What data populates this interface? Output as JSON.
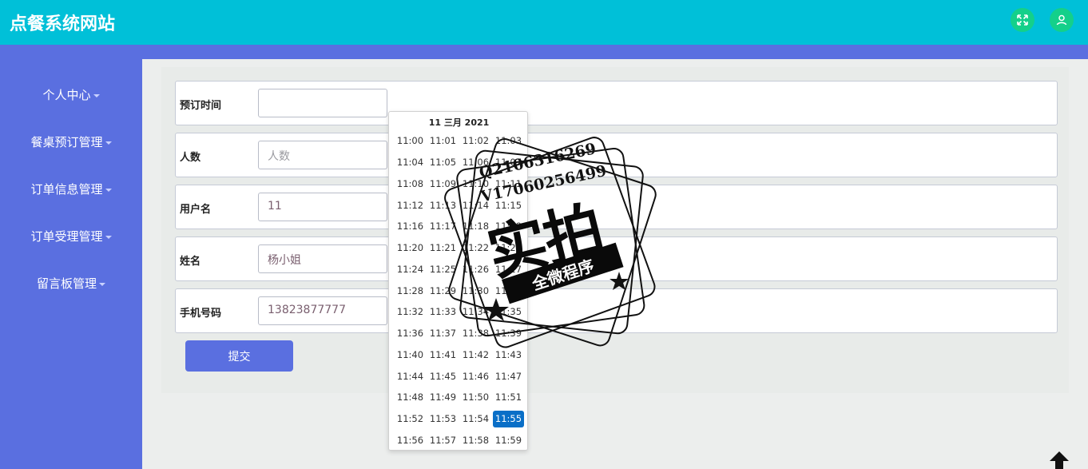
{
  "app": {
    "title": "点餐系统网站"
  },
  "header": {
    "buttons": [
      {
        "name": "fullscreen",
        "icon": "expand-icon"
      },
      {
        "name": "user",
        "icon": "user-icon"
      }
    ]
  },
  "sidebar": {
    "items": [
      {
        "label": "个人中心"
      },
      {
        "label": "餐桌预订管理"
      },
      {
        "label": "订单信息管理"
      },
      {
        "label": "订单受理管理"
      },
      {
        "label": "留言板管理"
      }
    ]
  },
  "form": {
    "fields": [
      {
        "label": "预订时间",
        "value": "",
        "placeholder": ""
      },
      {
        "label": "人数",
        "value": "",
        "placeholder": "人数"
      },
      {
        "label": "用户名",
        "value": "11",
        "placeholder": ""
      },
      {
        "label": "姓名",
        "value": "杨小姐",
        "placeholder": ""
      },
      {
        "label": "手机号码",
        "value": "13823877777",
        "placeholder": ""
      }
    ],
    "submit_label": "提交"
  },
  "picker": {
    "header": "11 三月 2021",
    "selected": "11:55",
    "times": [
      "11:00",
      "11:01",
      "11:02",
      "11:03",
      "11:04",
      "11:05",
      "11:06",
      "11:07",
      "11:08",
      "11:09",
      "11:10",
      "11:11",
      "11:12",
      "11:13",
      "11:14",
      "11:15",
      "11:16",
      "11:17",
      "11:18",
      "11:19",
      "11:20",
      "11:21",
      "11:22",
      "11:23",
      "11:24",
      "11:25",
      "11:26",
      "11:27",
      "11:28",
      "11:29",
      "11:30",
      "11:31",
      "11:32",
      "11:33",
      "11:34",
      "11:35",
      "11:36",
      "11:37",
      "11:38",
      "11:39",
      "11:40",
      "11:41",
      "11:42",
      "11:43",
      "11:44",
      "11:45",
      "11:46",
      "11:47",
      "11:48",
      "11:49",
      "11:50",
      "11:51",
      "11:52",
      "11:53",
      "11:54",
      "11:55",
      "11:56",
      "11:57",
      "11:58",
      "11:59"
    ]
  },
  "watermark": {
    "line1": "Q2106316269",
    "line2": "V17060256499",
    "big": "实拍",
    "ribbon": "全微程序"
  },
  "colors": {
    "header": "#00c0d8",
    "sidebar": "#5a6fe0",
    "selected": "#0a6fc7",
    "header_button": "#14d08a"
  }
}
